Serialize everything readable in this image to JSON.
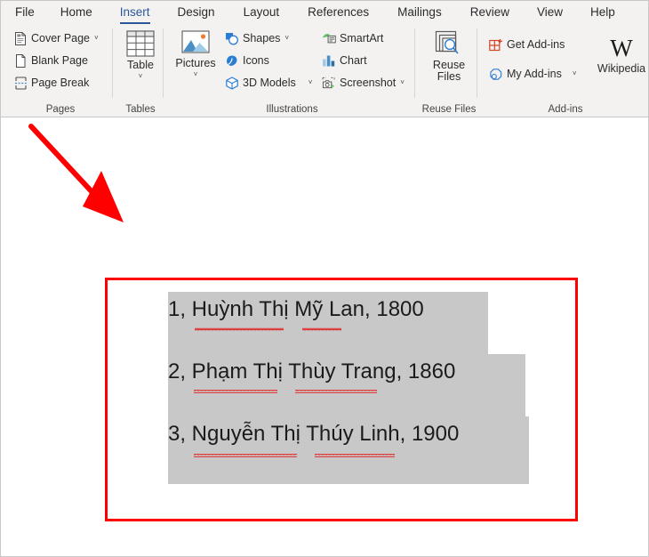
{
  "app": {
    "name": "Microsoft Word",
    "accent_color": "#2b579a",
    "ribbon_bg": "#f3f2f1",
    "annotation_color": "#ff0000",
    "selection_color": "#c8c8c8"
  },
  "tabs": [
    {
      "label": "File",
      "active": false
    },
    {
      "label": "Home",
      "active": false
    },
    {
      "label": "Insert",
      "active": true
    },
    {
      "label": "Design",
      "active": false
    },
    {
      "label": "Layout",
      "active": false
    },
    {
      "label": "References",
      "active": false
    },
    {
      "label": "Mailings",
      "active": false
    },
    {
      "label": "Review",
      "active": false
    },
    {
      "label": "View",
      "active": false
    },
    {
      "label": "Help",
      "active": false
    }
  ],
  "ribbon": {
    "groups": [
      {
        "label": "Pages",
        "commands": [
          {
            "label": "Cover Page",
            "icon": "cover-page-icon",
            "caret": "˅"
          },
          {
            "label": "Blank Page",
            "icon": "blank-page-icon",
            "caret": ""
          },
          {
            "label": "Page Break",
            "icon": "page-break-icon",
            "caret": ""
          }
        ]
      },
      {
        "label": "Tables",
        "commands": [
          {
            "label": "Table",
            "icon": "table-icon",
            "caret": "˅"
          }
        ]
      },
      {
        "label": "Illustrations",
        "commands": [
          {
            "label": "Pictures",
            "icon": "pictures-icon",
            "caret": "˅"
          },
          {
            "label": "Shapes",
            "icon": "shapes-icon",
            "caret": "˅"
          },
          {
            "label": "Icons",
            "icon": "icons-icon",
            "caret": ""
          },
          {
            "label": "3D Models",
            "icon": "3d-models-icon",
            "caret": "˅"
          },
          {
            "label": "SmartArt",
            "icon": "smartart-icon",
            "caret": ""
          },
          {
            "label": "Chart",
            "icon": "chart-icon",
            "caret": ""
          },
          {
            "label": "Screenshot",
            "icon": "screenshot-icon",
            "caret": "˅"
          }
        ]
      },
      {
        "label": "Reuse Files",
        "commands": [
          {
            "label": "Reuse\nFiles",
            "icon": "reuse-files-icon",
            "caret": ""
          }
        ]
      },
      {
        "label": "Add-ins",
        "commands": [
          {
            "label": "Get Add-ins",
            "icon": "get-addins-icon",
            "caret": ""
          },
          {
            "label": "My Add-ins",
            "icon": "my-addins-icon",
            "caret": "˅"
          },
          {
            "label": "Wikipedia",
            "icon": "wikipedia-icon",
            "caret": ""
          }
        ]
      }
    ],
    "labels": {
      "cover_page": "Cover Page",
      "blank_page": "Blank Page",
      "page_break": "Page Break",
      "table": "Table",
      "pictures": "Pictures",
      "shapes": "Shapes",
      "icons": "Icons",
      "models_3d": "3D Models",
      "smartart": "SmartArt",
      "chart": "Chart",
      "screenshot": "Screenshot",
      "reuse_files_line1": "Reuse",
      "reuse_files_line2": "Files",
      "get_addins": "Get Add-ins",
      "my_addins": "My Add-ins",
      "wikipedia": "Wikipedia"
    },
    "group_labels": {
      "pages": "Pages",
      "tables": "Tables",
      "illustrations": "Illustrations",
      "reuse_files": "Reuse Files",
      "addins": "Add-ins"
    },
    "caret": "˅"
  },
  "document": {
    "selected_lines": [
      "1, Huỳnh Thị Mỹ Lan, 1800",
      "2, Phạm Thị Thùy Trang, 1860",
      "3, Nguyễn Thị Thúy Linh, 1900"
    ]
  }
}
